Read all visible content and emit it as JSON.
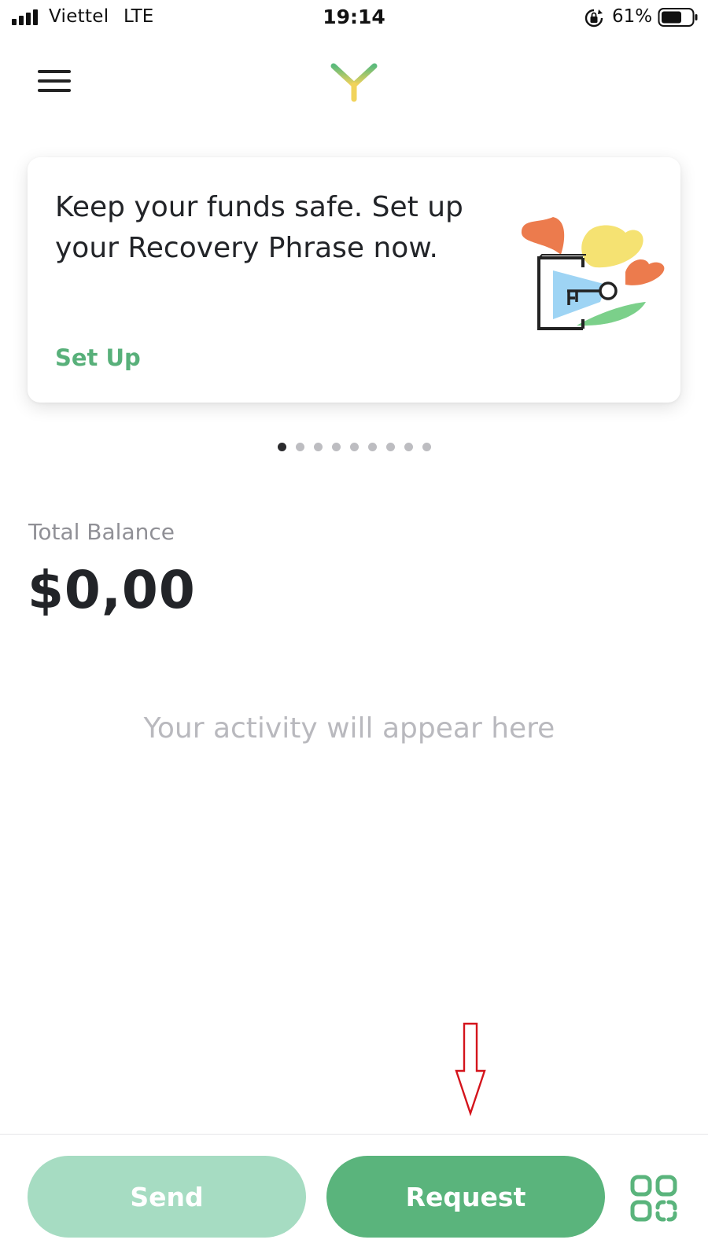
{
  "status_bar": {
    "carrier": "Viettel",
    "network": "LTE",
    "time": "19:14",
    "battery_percent": "61%"
  },
  "nav": {
    "menu_icon": "hamburger-menu-icon",
    "logo_icon": "v-logo-icon"
  },
  "promo_card": {
    "message": "Keep your funds safe. Set up your Recovery Phrase now.",
    "action_label": "Set Up",
    "illustration": "recovery-key-flowers-illustration"
  },
  "pager": {
    "count": 9,
    "active_index": 0
  },
  "balance": {
    "label": "Total Balance",
    "amount": "$0,00"
  },
  "activity": {
    "empty_message": "Your activity will appear here"
  },
  "actions": {
    "send_label": "Send",
    "request_label": "Request",
    "scan_icon": "qr-scan-icon"
  },
  "colors": {
    "accent": "#5ab47c",
    "accent_disabled": "#a6dcc2",
    "text_primary": "#222428",
    "text_muted": "#909096",
    "annotation": "#d4141c"
  }
}
